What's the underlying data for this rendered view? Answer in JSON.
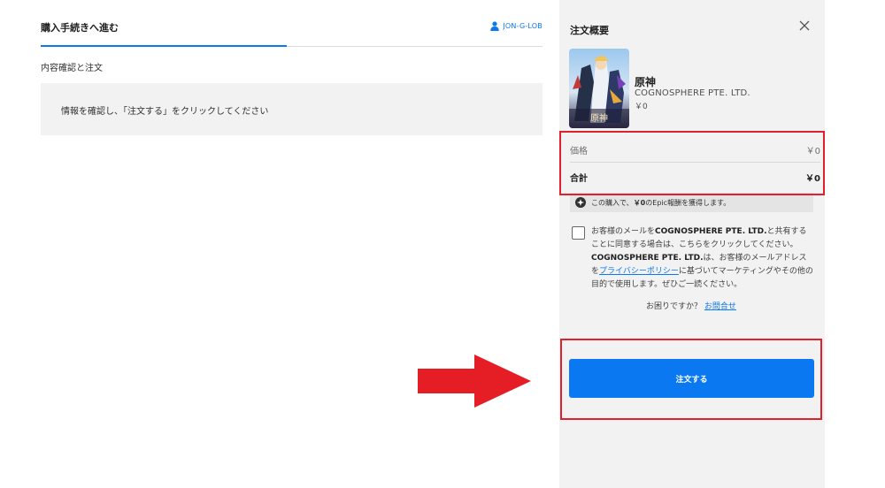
{
  "checkout": {
    "title": "購入手続きへ進む",
    "user_name": "JON-G-LOB",
    "section_title": "内容確認と注文",
    "info_message": "情報を確認し、「注文する」をクリックしてください"
  },
  "summary": {
    "title": "注文概要",
    "close_icon": "close-icon",
    "game": {
      "name": "原神",
      "publisher": "COGNOSPHERE PTE. LTD.",
      "price": "￥0",
      "cover_logo": "原神"
    },
    "price_label": "価格",
    "price_value": "￥0",
    "total_label": "合計",
    "total_value": "￥0",
    "reward": {
      "icon": "reward-icon",
      "prefix": "この購入で、",
      "amount": "￥0",
      "suffix": "のEpic報酬を獲得します。"
    },
    "consent": {
      "part1": "お客様のメールを",
      "company": "COGNOSPHERE PTE. LTD.",
      "part2": "と共有することに同意する場合は、こちらをクリックしてください。",
      "company2": "COGNOSPHERE PTE. LTD.",
      "part3": "は、お客様のメールアドレスを",
      "privacy_link": "プライバシーポリシー",
      "part4": "に基づいてマーケティングやその他の目的で使用します。ぜひご一読ください。"
    },
    "help_text": "お困りですか？",
    "help_link": "お問合せ",
    "order_button": "注文する"
  },
  "colors": {
    "accent": "#0a78f0",
    "highlight": "#e0202c",
    "panel_bg": "#f2f2f2"
  }
}
